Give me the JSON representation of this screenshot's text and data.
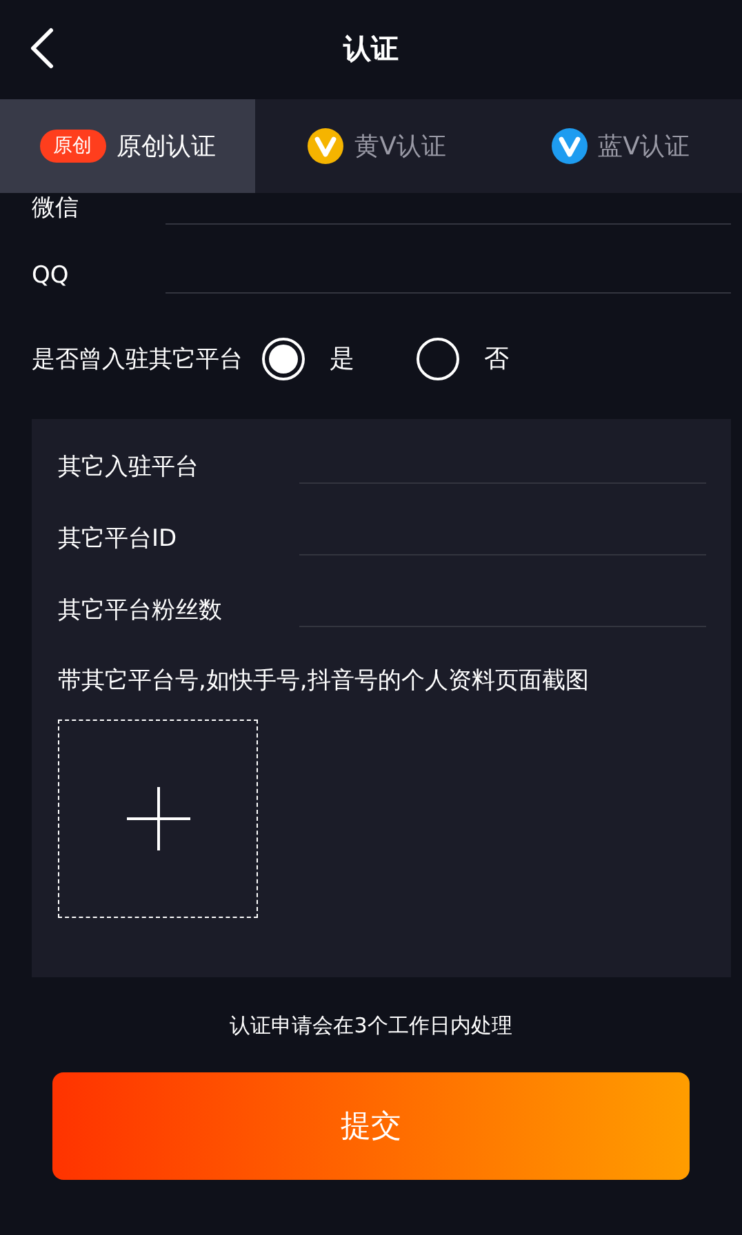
{
  "header": {
    "title": "认证"
  },
  "tabs": [
    {
      "label": "原创认证",
      "kind": "badge",
      "badge": "原创",
      "selected": true
    },
    {
      "label": "黄V认证",
      "kind": "v-icon",
      "color": "#f5b400",
      "selected": false
    },
    {
      "label": "蓝V认证",
      "kind": "v-icon",
      "color": "#1e9cf0",
      "selected": false
    }
  ],
  "fields": [
    {
      "label": "微信"
    },
    {
      "label": "QQ"
    }
  ],
  "question": {
    "label": "是否曾入驻其它平台",
    "options": [
      {
        "label": "是",
        "selected": true
      },
      {
        "label": "否",
        "selected": false
      }
    ]
  },
  "panel": {
    "fields": [
      {
        "label": "其它入驻平台"
      },
      {
        "label": "其它平台ID"
      },
      {
        "label": "其它平台粉丝数"
      }
    ],
    "upload_hint": "带其它平台号,如快手号,抖音号的个人资料页面截图"
  },
  "note": "认证申请会在3个工作日内处理",
  "submit": "提交"
}
